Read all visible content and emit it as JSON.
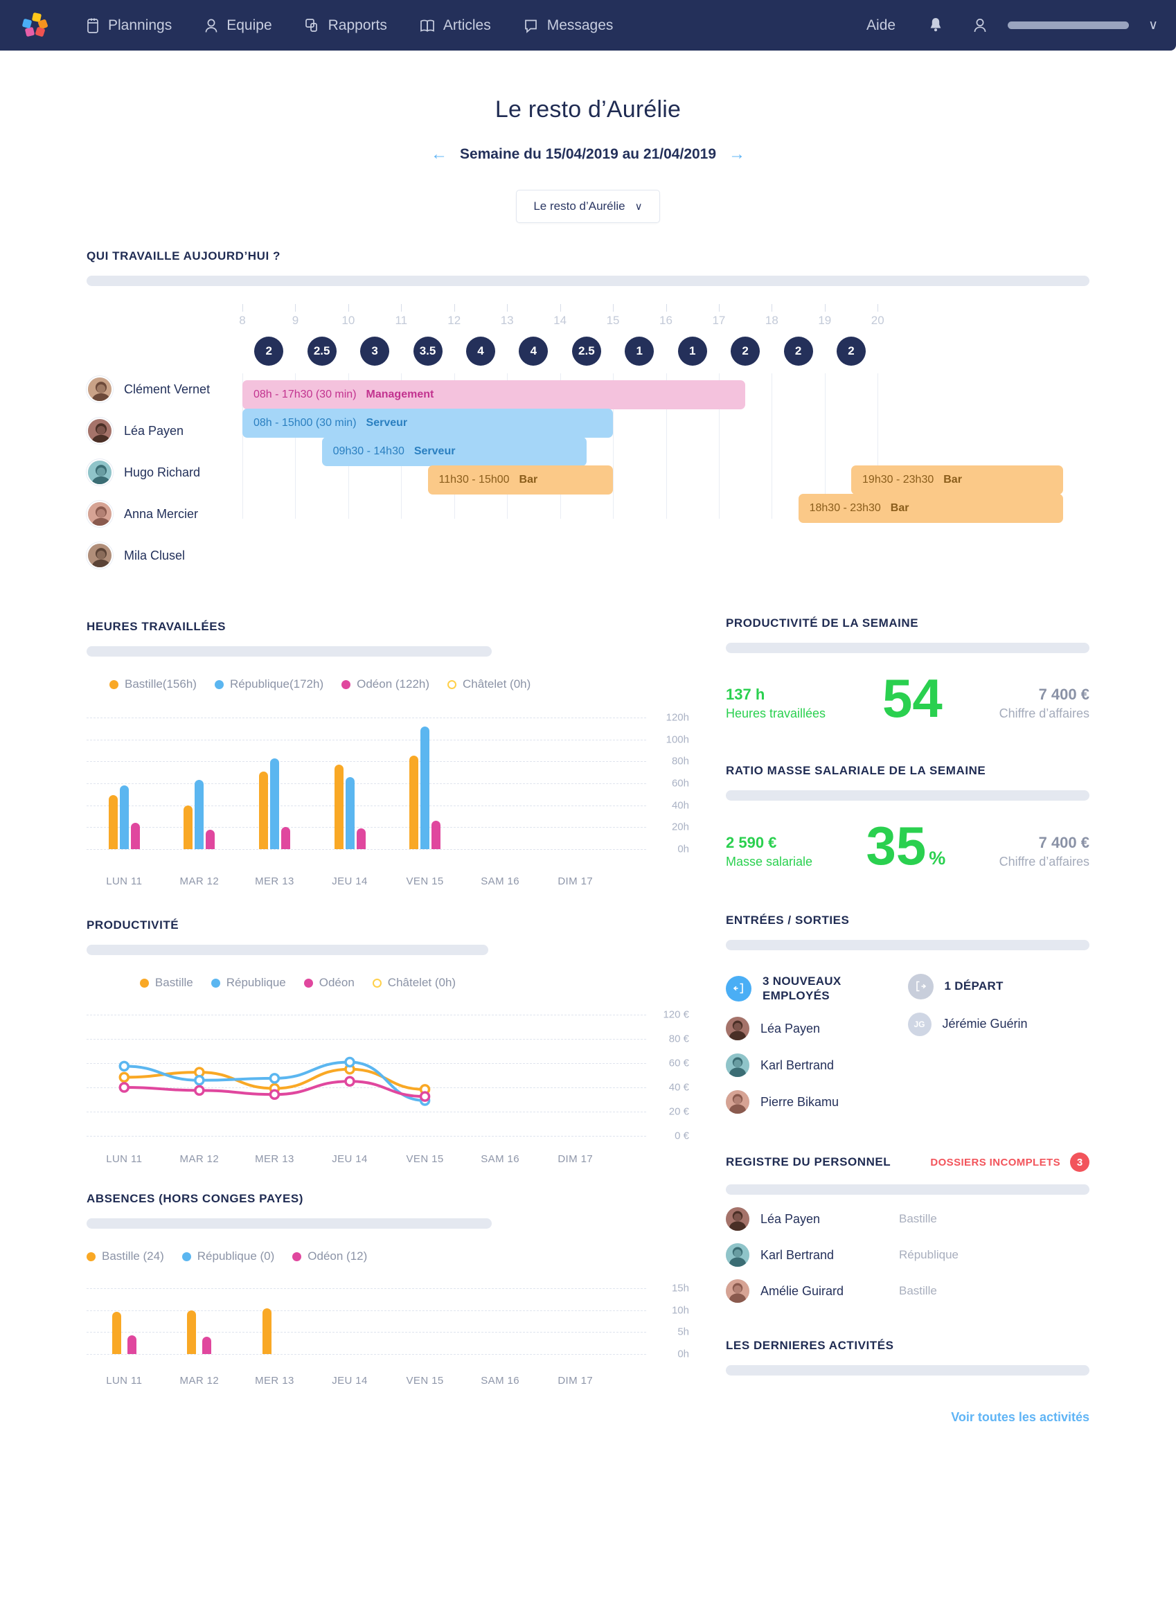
{
  "nav": {
    "logo": "snapshift-logo",
    "items": [
      {
        "label": "Plannings",
        "icon": "calendar-icon"
      },
      {
        "label": "Equipe",
        "icon": "user-icon"
      },
      {
        "label": "Rapports",
        "icon": "reports-icon"
      },
      {
        "label": "Articles",
        "icon": "book-icon"
      },
      {
        "label": "Messages",
        "icon": "message-icon"
      }
    ],
    "help": "Aide",
    "bell": "bell-icon",
    "account": "account-icon",
    "chevron": "∨"
  },
  "header": {
    "title": "Le resto d’Aurélie",
    "week": "Semaine du 15/04/2019 au 21/04/2019",
    "prev": "←",
    "next": "→",
    "selector": "Le resto d’Aurélie",
    "selector_chevron": "∨"
  },
  "today": {
    "title": "QUI TRAVAILLE AUJOURD’HUI ?",
    "hours": [
      "8",
      "9",
      "10",
      "11",
      "12",
      "13",
      "14",
      "15",
      "16",
      "17",
      "18",
      "19",
      "20"
    ],
    "bubbles": [
      "2",
      "2.5",
      "3",
      "3.5",
      "4",
      "4",
      "2.5",
      "1",
      "1",
      "2",
      "2",
      "2"
    ],
    "rows": [
      {
        "name": "Clément Vernet",
        "shifts": [
          {
            "time": "08h - 17h30 (30 min)",
            "role": "Management",
            "color": "pink",
            "start": 8,
            "end": 17.5
          }
        ]
      },
      {
        "name": "Léa Payen",
        "shifts": [
          {
            "time": "08h - 15h00 (30 min)",
            "role": "Serveur",
            "color": "blue",
            "start": 8,
            "end": 15
          }
        ]
      },
      {
        "name": "Hugo Richard",
        "shifts": [
          {
            "time": "09h30 - 14h30",
            "role": "Serveur",
            "color": "blue",
            "start": 9.5,
            "end": 14.5
          }
        ]
      },
      {
        "name": "Anna Mercier",
        "shifts": [
          {
            "time": "11h30 - 15h00",
            "role": "Bar",
            "color": "orange",
            "start": 11.5,
            "end": 15
          },
          {
            "time": "19h30 - 23h30",
            "role": "Bar",
            "color": "orange",
            "start": 19.5,
            "end": 23.5
          }
        ]
      },
      {
        "name": "Mila Clusel",
        "shifts": [
          {
            "time": "18h30 - 23h30",
            "role": "Bar",
            "color": "orange",
            "start": 18.5,
            "end": 23.5
          }
        ]
      }
    ]
  },
  "hours_worked": {
    "title": "HEURES TRAVAILLÉES",
    "legend": [
      {
        "label": "Bastille(156h)",
        "color": "#f9a825",
        "hollow": false
      },
      {
        "label": "République(172h)",
        "color": "#5bb6f0",
        "hollow": false
      },
      {
        "label": "Odéon (122h)",
        "color": "#e0479e",
        "hollow": false
      },
      {
        "label": "Châtelet  (0h)",
        "color": "#ffd04a",
        "hollow": true
      }
    ]
  },
  "productivity_chart": {
    "title": "PRODUCTIVITÉ",
    "legend": [
      {
        "label": "Bastille",
        "color": "#f9a825",
        "hollow": false
      },
      {
        "label": "République",
        "color": "#5bb6f0",
        "hollow": false
      },
      {
        "label": "Odéon",
        "color": "#e0479e",
        "hollow": false
      },
      {
        "label": "Châtelet (0h)",
        "color": "#ffd04a",
        "hollow": true
      }
    ]
  },
  "absences": {
    "title": "ABSENCES (HORS CONGES PAYES)",
    "legend": [
      {
        "label": "Bastille (24)",
        "color": "#f9a825",
        "hollow": false
      },
      {
        "label": "République (0)",
        "color": "#5bb6f0",
        "hollow": false
      },
      {
        "label": "Odéon  (12)",
        "color": "#e0479e",
        "hollow": false
      }
    ]
  },
  "chart_data": [
    {
      "type": "bar",
      "title": "HEURES TRAVAILLÉES",
      "categories": [
        "LUN 11",
        "MAR 12",
        "MER 13",
        "JEU 14",
        "VEN 15",
        "SAM 16",
        "DIM 17"
      ],
      "series": [
        {
          "name": "Bastille",
          "color": "#f9a825",
          "values": [
            49,
            40,
            71,
            77,
            85,
            0,
            0
          ]
        },
        {
          "name": "République",
          "color": "#5bb6f0",
          "values": [
            58,
            63,
            83,
            66,
            112,
            0,
            0
          ]
        },
        {
          "name": "Odéon",
          "color": "#e0479e",
          "values": [
            24,
            18,
            20,
            19,
            26,
            0,
            0
          ]
        },
        {
          "name": "Châtelet",
          "color": "#ffd04a",
          "values": [
            0,
            0,
            0,
            0,
            0,
            0,
            0
          ]
        }
      ],
      "ylabel": "",
      "xlabel": "",
      "yticks": [
        "0h",
        "20h",
        "40h",
        "60h",
        "80h",
        "100h",
        "120h"
      ],
      "ylim": [
        0,
        120
      ],
      "grid": true,
      "legend_position": "top-left",
      "totals": {
        "Bastille": "156h",
        "République": "172h",
        "Odéon": "122h",
        "Châtelet": "0h"
      }
    },
    {
      "type": "line",
      "title": "PRODUCTIVITÉ",
      "categories": [
        "LUN 11",
        "MAR 12",
        "MER 13",
        "JEU 14",
        "VEN 15",
        "SAM 16",
        "DIM 17"
      ],
      "series": [
        {
          "name": "Bastille",
          "color": "#f9a825",
          "values": [
            58,
            63,
            47,
            66,
            46
          ]
        },
        {
          "name": "République",
          "color": "#5bb6f0",
          "values": [
            69,
            55,
            57,
            73,
            35
          ]
        },
        {
          "name": "Odéon",
          "color": "#e0479e",
          "values": [
            48,
            45,
            41,
            54,
            39
          ]
        },
        {
          "name": "Châtelet",
          "color": "#ffd04a",
          "values": []
        }
      ],
      "yticks": [
        "0 €",
        "20 €",
        "40 €",
        "60 €",
        "80 €",
        "120 €"
      ],
      "ylim": [
        0,
        120
      ],
      "grid": true,
      "legend_position": "top-center"
    },
    {
      "type": "bar",
      "title": "ABSENCES (HORS CONGES PAYES)",
      "categories": [
        "LUN 11",
        "MAR 12",
        "MER 13",
        "JEU 14",
        "VEN 15",
        "SAM 16",
        "DIM 17"
      ],
      "series": [
        {
          "name": "Bastille",
          "color": "#f9a825",
          "values": [
            9.6,
            9.9,
            10.4,
            0,
            0,
            0,
            0
          ]
        },
        {
          "name": "République",
          "color": "#5bb6f0",
          "values": [
            0,
            0,
            0,
            0,
            0,
            0,
            0
          ]
        },
        {
          "name": "Odéon",
          "color": "#e0479e",
          "values": [
            4.3,
            4.0,
            0,
            0,
            0,
            0,
            0
          ]
        }
      ],
      "yticks": [
        "0h",
        "5h",
        "10h",
        "15h"
      ],
      "ylim": [
        0,
        15
      ],
      "grid": true,
      "legend_position": "top-left",
      "totals": {
        "Bastille": "24",
        "République": "0",
        "Odéon": "12"
      }
    }
  ],
  "week_productivity": {
    "title": "PRODUCTIVITÉ DE LA SEMAINE",
    "left_value": "137 h",
    "left_label": "Heures travaillées",
    "big_value": "54",
    "right_value": "7 400 €",
    "right_label": "Chiffre d’affaires"
  },
  "payroll_ratio": {
    "title": "RATIO MASSE SALARIALE DE LA SEMAINE",
    "left_value": "2 590 €",
    "left_label": "Masse salariale",
    "big_value": "35",
    "big_unit": "%",
    "right_value": "7 400 €",
    "right_label": "Chiffre d’affaires"
  },
  "inout": {
    "title": "ENTRÉES / SORTIES",
    "new_label": "3 NOUVEAUX EMPLOYÉS",
    "new_icon": "enter-door-icon",
    "leave_label": "1 DÉPART",
    "leave_icon": "exit-door-icon",
    "new_people": [
      "Léa Payen",
      "Karl Bertrand",
      "Pierre Bikamu"
    ],
    "leave_people": [
      {
        "name": "Jérémie Guérin",
        "initials": "JG"
      }
    ]
  },
  "registry": {
    "title": "REGISTRE DU PERSONNEL",
    "flag_label": "DOSSIERS INCOMPLETS",
    "flag_count": "3",
    "rows": [
      {
        "name": "Léa Payen",
        "site": "Bastille"
      },
      {
        "name": "Karl Bertrand",
        "site": "République"
      },
      {
        "name": "Amélie Guirard",
        "site": "Bastille"
      }
    ]
  },
  "activities": {
    "title": "LES DERNIERES ACTIVITÉS",
    "link": "Voir toutes les activités"
  },
  "colors": {
    "navy": "#24305a",
    "orange": "#f9a825",
    "blue": "#5bb6f0",
    "magenta": "#e0479e",
    "yellow": "#ffd04a",
    "green": "#2ad04f",
    "red": "#f2545b",
    "link": "#5fb4f5"
  }
}
